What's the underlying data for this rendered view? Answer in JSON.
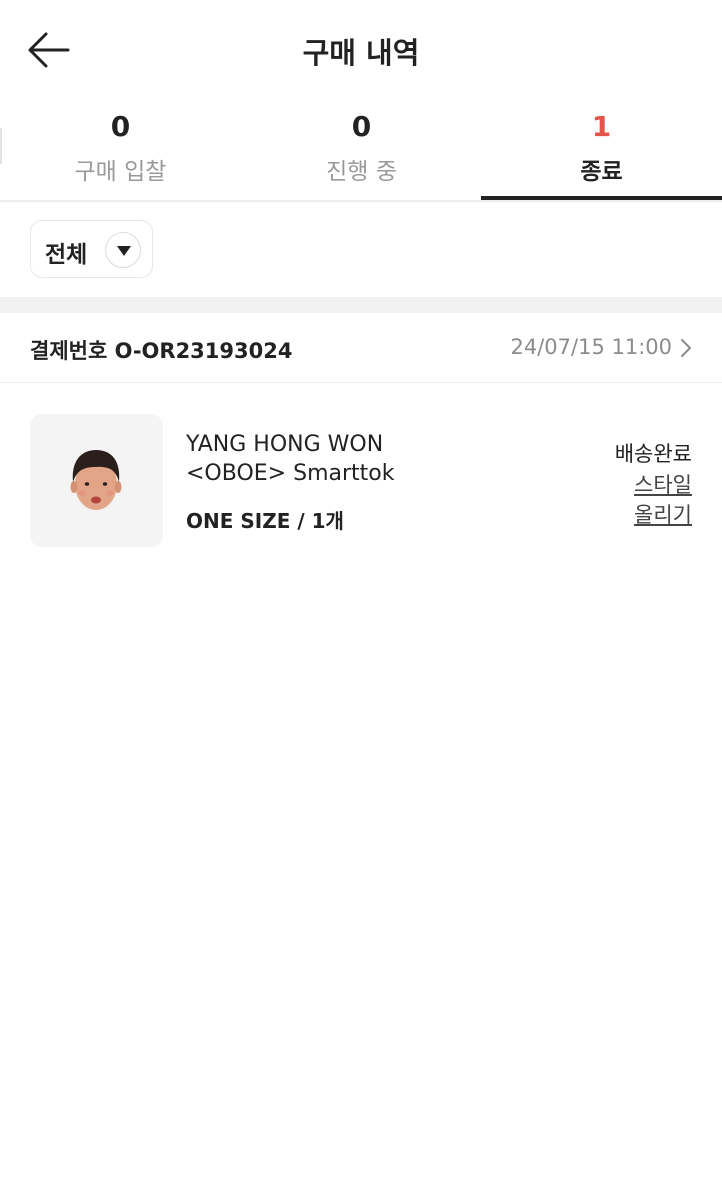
{
  "header": {
    "title": "구매 내역",
    "back_icon": "arrow-left-icon"
  },
  "tabs": [
    {
      "count": "0",
      "label": "구매 입찰",
      "active": false
    },
    {
      "count": "0",
      "label": "진행 중",
      "active": false
    },
    {
      "count": "1",
      "label": "종료",
      "active": true
    }
  ],
  "filter": {
    "label": "전체",
    "icon": "caret-down-icon"
  },
  "order": {
    "number_label": "결제번호 O-OR23193024",
    "datetime": "24/07/15 11:00",
    "chevron_icon": "chevron-right-icon"
  },
  "product": {
    "image_icon": "product-image",
    "brand": "YANG HONG WON",
    "name": "<OBOE> Smarttok",
    "option": "ONE SIZE / 1개",
    "status": "배송완료",
    "style_link_line1": "스타일",
    "style_link_line2": "올리기"
  },
  "colors": {
    "accent": "#e5544b",
    "text": "#222222",
    "muted": "#9a9a9a"
  }
}
